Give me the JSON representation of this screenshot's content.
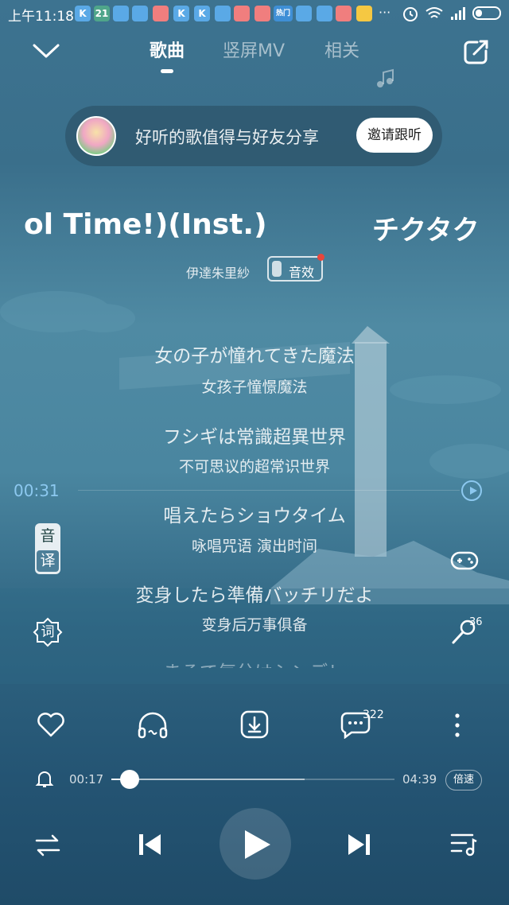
{
  "status_bar": {
    "time": "上午11:18",
    "app_icons": [
      "K",
      "21",
      "",
      "",
      "",
      "K",
      "K",
      "",
      "",
      "",
      "热门",
      "",
      "",
      "",
      ""
    ]
  },
  "header": {
    "tabs": [
      {
        "label": "歌曲",
        "active": true
      },
      {
        "label": "竖屏MV",
        "active": false
      },
      {
        "label": "相关",
        "active": false
      }
    ]
  },
  "invite": {
    "text": "好听的歌值得与好友分享",
    "button_label": "邀请跟听"
  },
  "song": {
    "title_scroll": "ol Time!)(Inst.)",
    "title_next": "チクタク",
    "artist": "伊達朱里紗",
    "sound_effect_label": "音效"
  },
  "lyrics": [
    {
      "original": "女の子が憧れてきた魔法",
      "translation": "女孩子憧憬魔法"
    },
    {
      "original": "フシギは常識超異世界",
      "translation": "不可思议的超常识世界"
    },
    {
      "original": "唱えたらショウタイム",
      "translation": "咏唱咒语 演出时间"
    },
    {
      "original": "変身したら準備バッチリだよ",
      "translation": "变身后万事俱备"
    }
  ],
  "lyric_next_partial": "まるで気分はシンデレ",
  "seek_time": "00:31",
  "side_tools": {
    "phonetic_label": "音",
    "translate_label": "译",
    "lyric_style_label": "词",
    "karaoke_count": "36"
  },
  "actions": {
    "comment_count": "322"
  },
  "playback": {
    "current_time": "00:17",
    "total_time": "04:39",
    "speed_label": "倍速",
    "progress": 0.065
  }
}
